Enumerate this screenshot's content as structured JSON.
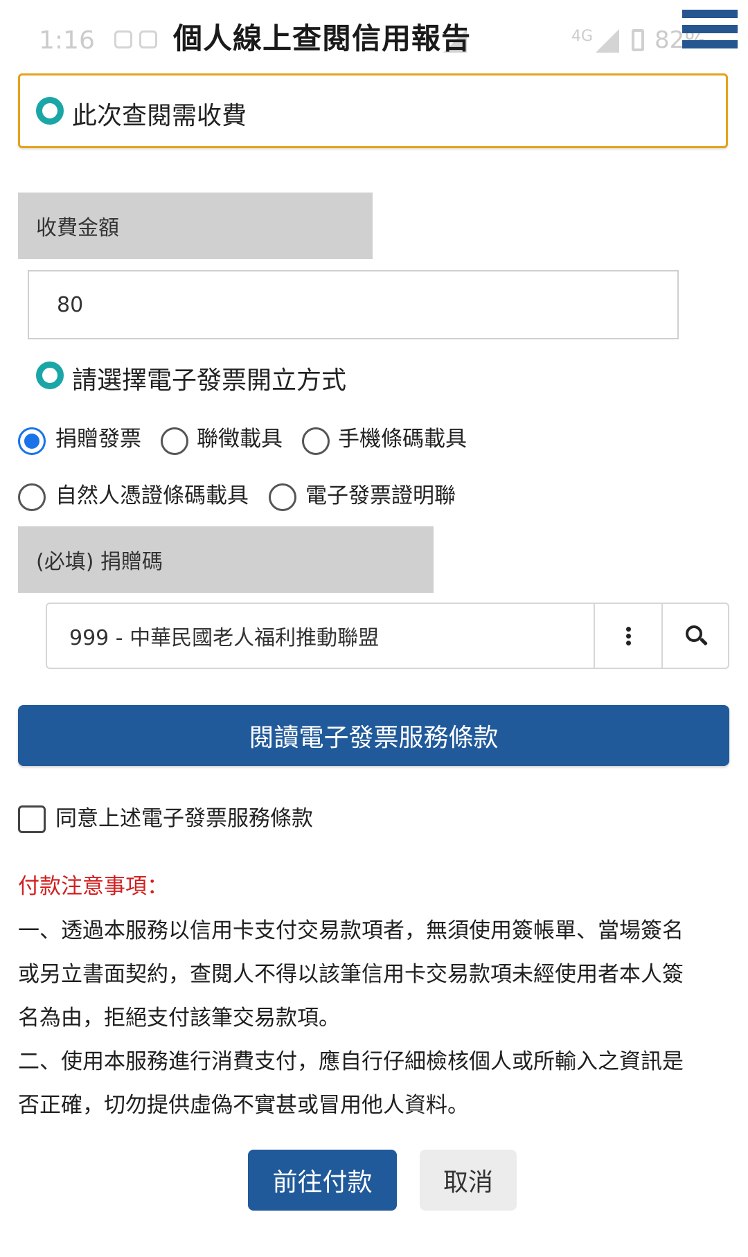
{
  "status_bar": {
    "time": "1:16",
    "network": "4G",
    "battery": "82%"
  },
  "header": {
    "title": "個人線上查閱信用報告"
  },
  "notice": {
    "text": "此次查閱需收費"
  },
  "fee": {
    "label": "收費金額",
    "value": "80"
  },
  "invoice": {
    "section_label": "請選擇電子發票開立方式",
    "options": [
      {
        "label": "捐贈發票",
        "checked": true
      },
      {
        "label": "聯徵載具",
        "checked": false
      },
      {
        "label": "手機條碼載具",
        "checked": false
      },
      {
        "label": "自然人憑證條碼載具",
        "checked": false
      },
      {
        "label": "電子發票證明聯",
        "checked": false
      }
    ]
  },
  "donation": {
    "label": "(必填) 捐贈碼",
    "value": "999 - 中華民國老人福利推動聯盟"
  },
  "terms": {
    "button_label": "閱讀電子發票服務條款",
    "agree_label": "同意上述電子發票服務條款"
  },
  "payment_notes": {
    "title": "付款注意事項：",
    "lines": [
      "一、透過本服務以信用卡支付交易款項者，無須使用簽帳單、當場簽名",
      "或另立書面契約，查閱人不得以該筆信用卡交易款項未經使用者本人簽",
      "名為由，拒絕支付該筆交易款項。",
      "二、使用本服務進行消費支付，應自行仔細檢核個人或所輸入之資訊是",
      "否正確，切勿提供虛偽不實甚或冒用他人資料。"
    ]
  },
  "actions": {
    "pay_label": "前往付款",
    "cancel_label": "取消"
  },
  "colors": {
    "primary": "#215a9a",
    "accent_border": "#e3a21a",
    "ring": "#1aa6a6",
    "warning": "#d21f1f",
    "radio_checked": "#1a73e8"
  }
}
